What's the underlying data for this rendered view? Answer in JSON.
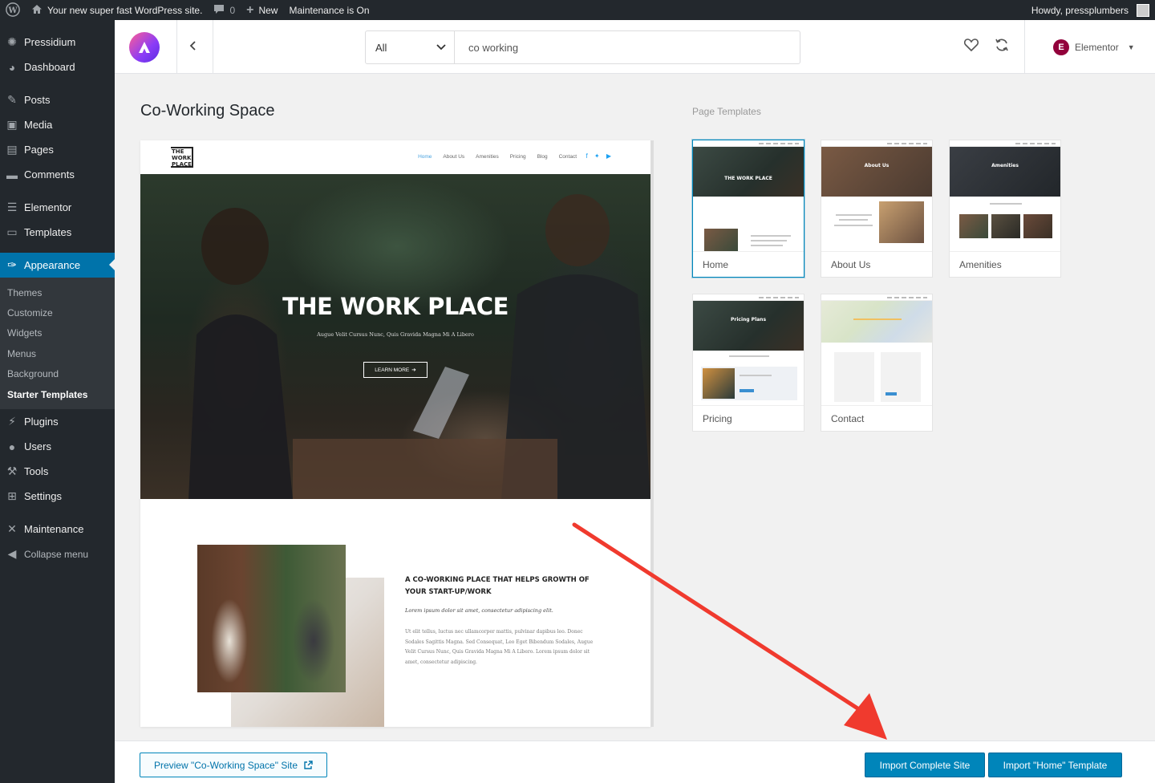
{
  "adminbar": {
    "site_name": "Your new super fast WordPress site.",
    "comments_count": "0",
    "new_label": "New",
    "maintenance_label": "Maintenance is On",
    "howdy": "Howdy, pressplumbers"
  },
  "sidebar": {
    "items": [
      {
        "label": "Pressidium",
        "icon": "pressidium-icon"
      },
      {
        "label": "Dashboard",
        "icon": "dashboard-icon"
      },
      {
        "label": "Posts",
        "icon": "pin-icon"
      },
      {
        "label": "Media",
        "icon": "media-icon"
      },
      {
        "label": "Pages",
        "icon": "pages-icon"
      },
      {
        "label": "Comments",
        "icon": "comment-icon"
      },
      {
        "label": "Elementor",
        "icon": "elementor-icon"
      },
      {
        "label": "Templates",
        "icon": "folder-icon"
      },
      {
        "label": "Appearance",
        "icon": "brush-icon"
      },
      {
        "label": "Plugins",
        "icon": "plug-icon"
      },
      {
        "label": "Users",
        "icon": "user-icon"
      },
      {
        "label": "Tools",
        "icon": "wrench-icon"
      },
      {
        "label": "Settings",
        "icon": "settings-icon"
      },
      {
        "label": "Maintenance",
        "icon": "tools-icon"
      },
      {
        "label": "Collapse menu",
        "icon": "collapse-icon"
      }
    ],
    "appearance_sub": [
      "Themes",
      "Customize",
      "Widgets",
      "Menus",
      "Background",
      "Starter Templates"
    ]
  },
  "header": {
    "filter_value": "All",
    "search_value": "co working",
    "page_builder": "Elementor"
  },
  "main": {
    "site_title": "Co-Working Space",
    "page_templates_label": "Page Templates"
  },
  "preview": {
    "logo_text": [
      "THE",
      "WORK",
      "PLACE"
    ],
    "nav_links": [
      "Home",
      "About Us",
      "Amenities",
      "Pricing",
      "Blog",
      "Contact"
    ],
    "hero_title": "THE WORK PLACE",
    "hero_subtitle": "Augue Velit Cursus Nunc, Quis Gravida Magna Mi A Libero",
    "hero_button": "LEARN MORE",
    "section_heading": "A CO-WORKING PLACE THAT HELPS GROWTH OF YOUR START-UP/WORK",
    "section_italic": "Lorem ipsum dolor sit amet, consectetur adipiscing elit.",
    "section_body": "Ut elit tellus, luctus nec ullamcorper mattis, pulvinar dapibus leo. Donec Sodales Sagittis Magna. Sed Consequat, Leo Eget Bibendum Sodales, Augue Velit Cursus Nunc, Quis Gravida Magna Mi A Libero. Lorem ipsum dolor sit amet, consectetur adipiscing."
  },
  "templates": [
    {
      "label": "Home",
      "thumb_title": "THE WORK PLACE",
      "selected": true
    },
    {
      "label": "About Us",
      "thumb_title": "About Us",
      "selected": false
    },
    {
      "label": "Amenities",
      "thumb_title": "Amenities",
      "selected": false
    },
    {
      "label": "Pricing",
      "thumb_title": "Pricing Plans",
      "selected": false
    },
    {
      "label": "Contact",
      "thumb_title": "",
      "selected": false
    }
  ],
  "footer": {
    "preview_label": "Preview \"Co-Working Space\" Site",
    "import_site_label": "Import Complete Site",
    "import_template_label": "Import \"Home\" Template"
  },
  "colors": {
    "admin_dark": "#23282d",
    "wp_blue": "#0085ba",
    "annotation_red": "#f03a2e",
    "elementor": "#92003b"
  }
}
